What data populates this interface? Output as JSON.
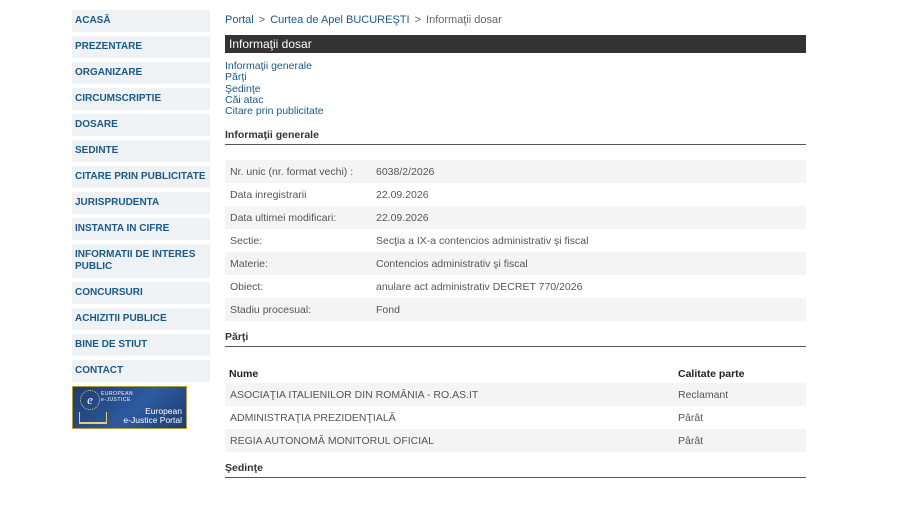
{
  "sidebar": {
    "items": [
      {
        "label": "ACASĂ"
      },
      {
        "label": "PREZENTARE"
      },
      {
        "label": "ORGANIZARE"
      },
      {
        "label": "CIRCUMSCRIPTIE"
      },
      {
        "label": "DOSARE"
      },
      {
        "label": "SEDINTE"
      },
      {
        "label": "CITARE PRIN PUBLICITATE"
      },
      {
        "label": "JURISPRUDENTA"
      },
      {
        "label": "INSTANTA IN CIFRE"
      },
      {
        "label": "INFORMATII DE INTERES PUBLIC"
      },
      {
        "label": "CONCURSURI"
      },
      {
        "label": "ACHIZITII PUBLICE"
      },
      {
        "label": "BINE DE STIUT"
      },
      {
        "label": "CONTACT"
      }
    ],
    "banner": {
      "logo_letter": "e",
      "top_line1": "EUROPEAN",
      "top_line2": "e-JUSTICE",
      "bottom_line1": "European",
      "bottom_line2": "e-Justice Portal"
    }
  },
  "breadcrumb": {
    "portal": "Portal",
    "court": "Curtea de Apel BUCUREŞTI",
    "current": "Informaţii dosar",
    "separator": ">"
  },
  "page_title": "Informaţii dosar",
  "toc": {
    "items": [
      {
        "label": "Informaţii generale"
      },
      {
        "label": "Părţi"
      },
      {
        "label": "Şedinţe"
      },
      {
        "label": "Căi atac"
      },
      {
        "label": "Citare prin publicitate"
      }
    ]
  },
  "general": {
    "heading": "Informaţii generale",
    "rows": [
      {
        "label": "Nr. unic (nr. format vechi) :",
        "value": "6038/2/2026"
      },
      {
        "label": "Data inregistrarii",
        "value": "22.09.2026"
      },
      {
        "label": "Data ultimei modificari:",
        "value": "22.09.2026"
      },
      {
        "label": "Sectie:",
        "value": "Secţia a IX-a contencios administrativ şi fiscal"
      },
      {
        "label": "Materie:",
        "value": "Contencios administrativ şi fiscal"
      },
      {
        "label": "Obiect:",
        "value": "anulare act administrativ DECRET 770/2026"
      },
      {
        "label": "Stadiu procesual:",
        "value": "Fond"
      }
    ]
  },
  "parti": {
    "heading": "Părţi",
    "columns": {
      "name": "Nume",
      "role": "Calitate parte"
    },
    "rows": [
      {
        "name": "ASOCIAŢIA ITALIENILOR DIN ROMÂNIA - RO.AS.IT",
        "role": "Reclamant"
      },
      {
        "name": "ADMINISTRAŢIA PREZIDENŢIALĂ",
        "role": "Pârât"
      },
      {
        "name": "REGIA AUTONOMĂ MONITORUL OFICIAL",
        "role": "Pârât"
      }
    ]
  },
  "sedinte": {
    "heading": "Şedinţe"
  }
}
